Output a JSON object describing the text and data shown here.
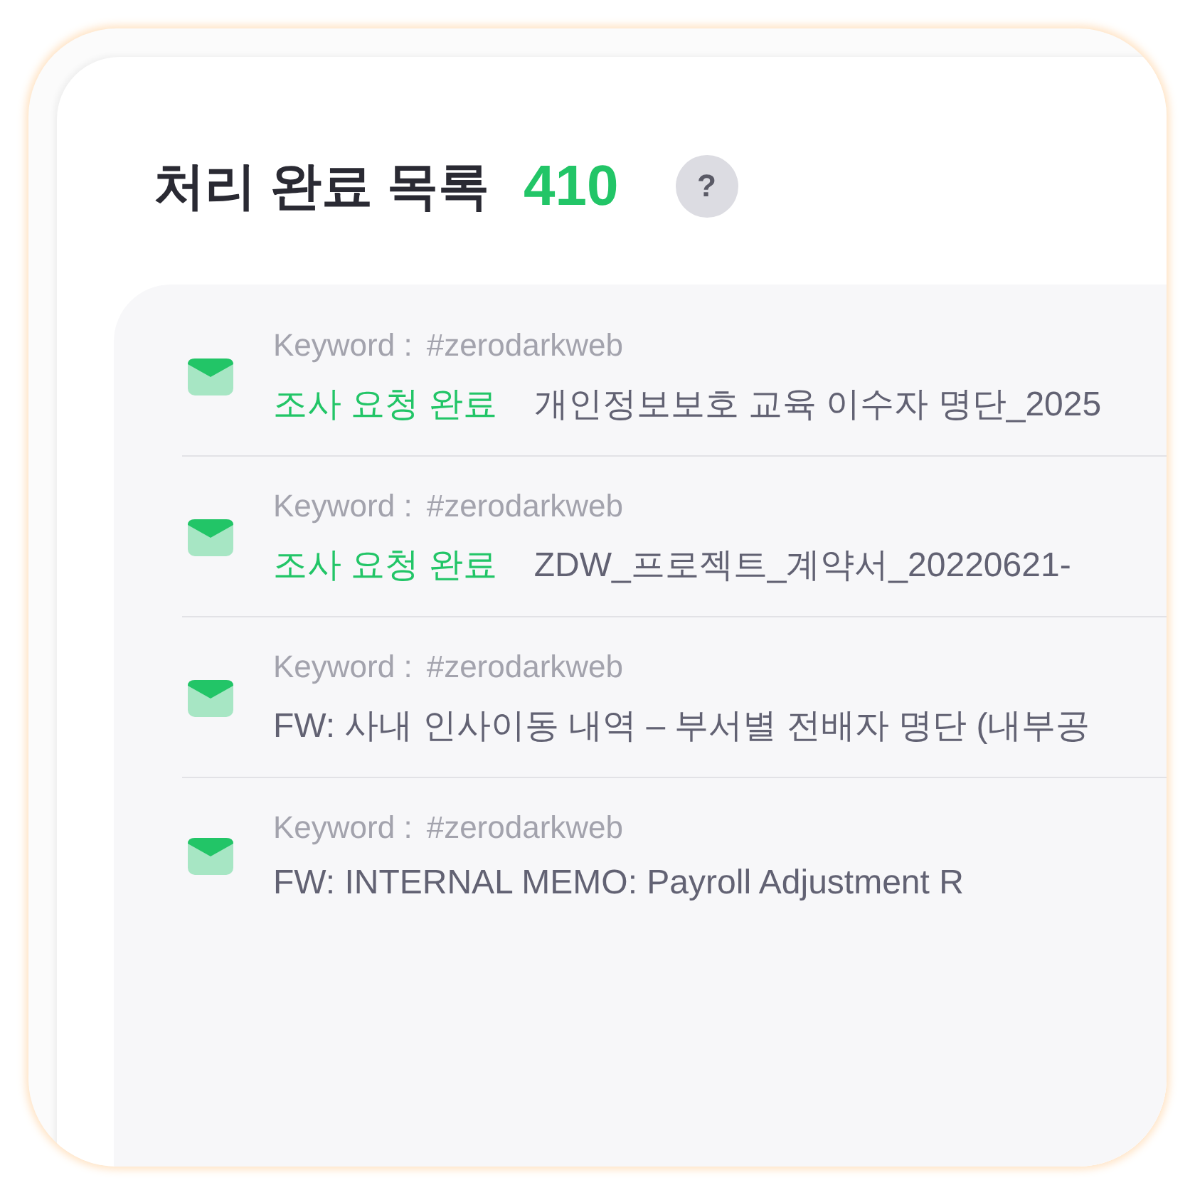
{
  "header": {
    "title": "처리 완료 목록",
    "count": "410",
    "help": "?"
  },
  "items": [
    {
      "keyword_label": "Keyword :",
      "keyword": "#zerodarkweb",
      "status": "조사 요청 완료",
      "subject": "개인정보보호 교육 이수자 명단_2025"
    },
    {
      "keyword_label": "Keyword :",
      "keyword": "#zerodarkweb",
      "status": "조사 요청 완료",
      "subject": "ZDW_프로젝트_계약서_20220621-"
    },
    {
      "keyword_label": "Keyword :",
      "keyword": "#zerodarkweb",
      "subject": "FW: 사내 인사이동 내역 – 부서별 전배자 명단 (내부공"
    },
    {
      "keyword_label": "Keyword :",
      "keyword": "#zerodarkweb",
      "subject": "FW: INTERNAL MEMO: Payroll Adjustment R"
    }
  ]
}
